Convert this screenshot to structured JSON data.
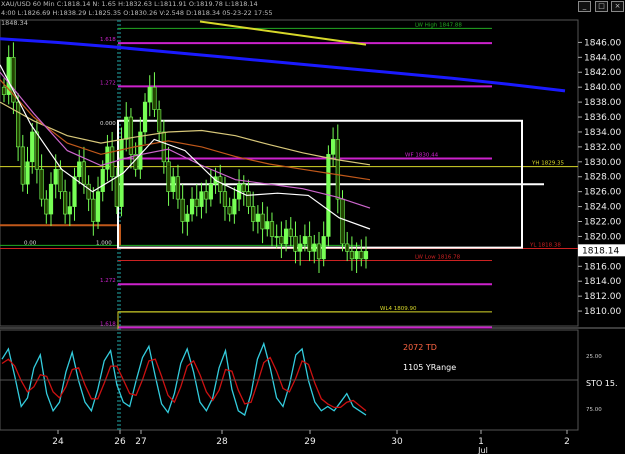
{
  "header": {
    "symbol_line": "XAU/USD 60 Min C:1818.14 N: 1.65 H:1832.63 L:1811.91 O:1819.78 L:1818.14",
    "ohlc_line": "4:00 L:1826.69 H:1838.29 L:1825.35 O:1830.26 V:2.548 D:1818.34 05-23-22 17:55",
    "last_price": "1848.34"
  },
  "window_buttons": {
    "minimize": "_",
    "maximize": "□",
    "close": "×"
  },
  "colors": {
    "background": "#000000",
    "candle_up": "#77ff55",
    "candle_down": "#224400",
    "sma_long": "#1a1aff",
    "sma_mid": "#d8c87a",
    "ema_fast": "#ffffff",
    "ema_orange": "#c0581a",
    "ema_pink": "#cc66cc",
    "box": "#ffffff",
    "level_magenta": "#cc22cc",
    "level_red": "#cc2222",
    "level_green": "#22aa22",
    "level_yellow": "#d8d82a",
    "stoch_k": "#33ccdd",
    "stoch_d": "#cc1111",
    "session_line": "#22aaaa"
  },
  "chart_data": [
    {
      "type": "candlestick",
      "title": "XAU/USD 60 Min",
      "ylim": [
        1808,
        1849
      ],
      "y_ticks": [
        "1846.00",
        "1844.00",
        "1842.00",
        "1840.00",
        "1838.00",
        "1836.00",
        "1834.00",
        "1832.00",
        "1830.00",
        "1828.00",
        "1826.00",
        "1824.00",
        "1822.00",
        "1820.00",
        "1818.00",
        "1816.00",
        "1814.00",
        "1812.00",
        "1810.00"
      ],
      "last_price_label": "1818.14",
      "x_labels": [
        "24",
        "26",
        "27",
        "28",
        "29",
        "30",
        "1",
        "2"
      ],
      "x_sublabel": "Jul",
      "grid": false,
      "close_series": [
        1839,
        1844,
        1838,
        1832,
        1827,
        1830,
        1834,
        1829,
        1825,
        1823,
        1827,
        1829,
        1826,
        1823,
        1824,
        1828,
        1830,
        1827,
        1825,
        1822,
        1826,
        1829,
        1832,
        1828,
        1824,
        1833,
        1836,
        1831,
        1829,
        1834,
        1838,
        1840,
        1837,
        1834,
        1830,
        1826,
        1828,
        1825,
        1822,
        1823,
        1825,
        1824,
        1826,
        1825,
        1827,
        1828,
        1826,
        1824,
        1823,
        1825,
        1827,
        1826,
        1824,
        1822,
        1823,
        1821,
        1822,
        1820,
        1820,
        1819,
        1821,
        1820,
        1818,
        1819,
        1820,
        1818,
        1819,
        1817,
        1820,
        1831,
        1833,
        1825,
        1819,
        1818,
        1817,
        1818,
        1817,
        1818
      ],
      "moving_averages": [
        {
          "color_key": "sma_long",
          "values": [
            1846.5,
            1846.0,
            1845.4,
            1844.7,
            1844.0,
            1843.3,
            1842.6,
            1841.9,
            1841.2,
            1840.4,
            1839.5
          ]
        },
        {
          "color_key": "sma_mid",
          "values": [
            1838.0,
            1835.5,
            1833.5,
            1832.5,
            1833.3,
            1834.0,
            1834.2,
            1833.5,
            1832.3,
            1831.2,
            1830.3,
            1829.6
          ]
        },
        {
          "color_key": "ema_orange",
          "values": [
            1841.0,
            1836.0,
            1832.5,
            1831.0,
            1832.0,
            1832.8,
            1832.0,
            1830.7,
            1829.7,
            1829.0,
            1828.3,
            1827.6
          ]
        },
        {
          "color_key": "ema_pink",
          "values": [
            1842.0,
            1836.5,
            1831.5,
            1829.5,
            1830.8,
            1831.7,
            1829.5,
            1827.6,
            1827.0,
            1826.4,
            1825.3,
            1823.8
          ]
        },
        {
          "color_key": "ema_fast",
          "values": [
            1843.0,
            1835.0,
            1829.0,
            1826.0,
            1828.5,
            1833.0,
            1831.5,
            1827.5,
            1825.5,
            1825.8,
            1825.5,
            1822.5,
            1821.0
          ]
        }
      ],
      "levels": [
        {
          "value": 1847.88,
          "label": "LW High 1847.88",
          "color_key": "level_green"
        },
        {
          "value": 1845.9,
          "label": "1.618",
          "color_key": "level_magenta"
        },
        {
          "value": 1840.1,
          "label": "1.272",
          "color_key": "level_magenta"
        },
        {
          "value": 1830.44,
          "label": "WF 1830.44",
          "color_key": "level_magenta"
        },
        {
          "value": 1829.35,
          "label": "YH 1829.35",
          "color_key": "level_yellow"
        },
        {
          "value": 1818.38,
          "label": "YL 1818.38",
          "color_key": "level_red"
        },
        {
          "value": 1816.78,
          "label": "LW Low 1816.78",
          "color_key": "level_red"
        },
        {
          "value": 1813.6,
          "label": "1.272",
          "color_key": "level_magenta"
        },
        {
          "value": 1809.9,
          "label": "WL4 1809.90",
          "color_key": "level_yellow"
        },
        {
          "value": 1807.8,
          "label": "1.618",
          "color_key": "level_magenta"
        }
      ],
      "fib_labels": [
        "1.000",
        "0.000",
        "0.00"
      ],
      "box": {
        "top": 1835.5,
        "bottom": 1818.5,
        "mid": 1827.0
      }
    },
    {
      "type": "line",
      "title": "Stochastic",
      "ylim": [
        0,
        100
      ],
      "series": [
        {
          "color_key": "stoch_k",
          "values": [
            80,
            92,
            60,
            25,
            35,
            70,
            85,
            40,
            20,
            30,
            65,
            88,
            55,
            30,
            20,
            45,
            78,
            90,
            50,
            30,
            25,
            55,
            82,
            95,
            60,
            28,
            18,
            40,
            75,
            92,
            65,
            30,
            20,
            35,
            70,
            90,
            45,
            20,
            15,
            40,
            80,
            98,
            70,
            35,
            25,
            50,
            85,
            92,
            55,
            30,
            20,
            25,
            20,
            30,
            40,
            25,
            20,
            15
          ]
        },
        {
          "color_key": "stoch_d",
          "values": [
            75,
            80,
            72,
            55,
            42,
            48,
            62,
            60,
            42,
            35,
            48,
            68,
            70,
            50,
            34,
            34,
            52,
            72,
            72,
            56,
            40,
            38,
            56,
            78,
            80,
            60,
            38,
            30,
            48,
            72,
            78,
            62,
            42,
            32,
            44,
            68,
            66,
            44,
            28,
            30,
            52,
            76,
            82,
            66,
            46,
            42,
            58,
            78,
            74,
            52,
            34,
            28,
            24,
            24,
            30,
            32,
            26,
            20
          ]
        }
      ],
      "annotations": [
        "2072 TD",
        "1105 YRange"
      ],
      "axis_labels": [
        "25.00",
        "STO  15.",
        "75.00"
      ]
    }
  ]
}
